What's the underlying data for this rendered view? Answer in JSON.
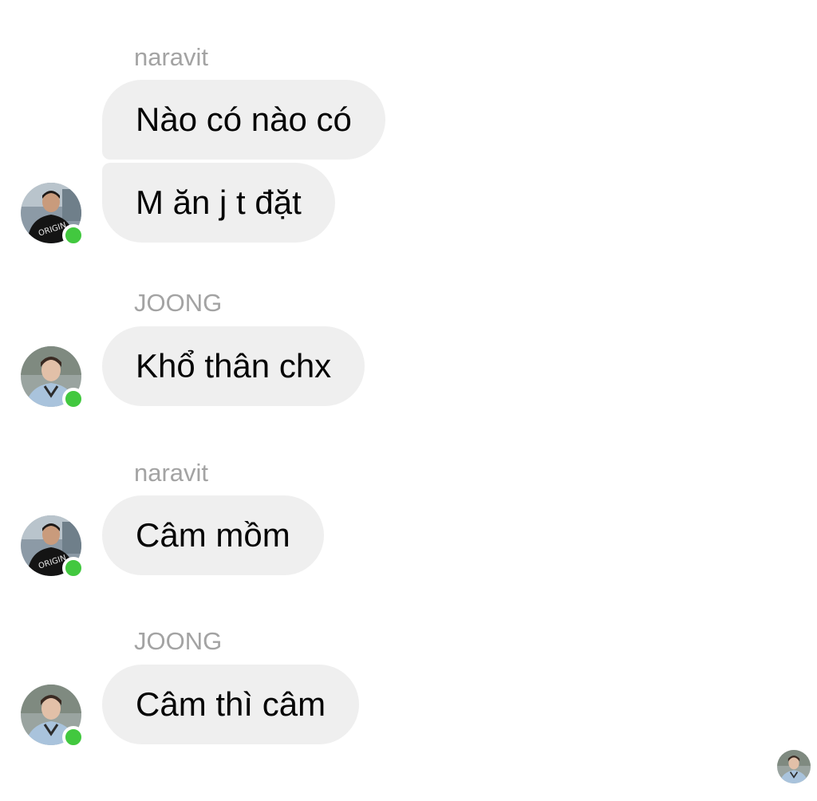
{
  "conversation": {
    "groups": [
      {
        "sender": "naravit",
        "avatar_icon": "person-in-black-tshirt-avatar",
        "online": true,
        "messages": [
          "Nào có nào có",
          "M ăn j t đặt"
        ]
      },
      {
        "sender": "JOONG",
        "avatar_icon": "person-in-light-shirt-avatar",
        "online": true,
        "messages": [
          "Khổ thân chx"
        ]
      },
      {
        "sender": "naravit",
        "avatar_icon": "person-in-black-tshirt-avatar",
        "online": true,
        "messages": [
          "Câm mồm"
        ]
      },
      {
        "sender": "JOONG",
        "avatar_icon": "person-in-light-shirt-avatar",
        "online": true,
        "messages": [
          "Câm thì câm"
        ]
      }
    ],
    "seen_by_icon": "read-receipt-avatar"
  },
  "colors": {
    "bubble_bg": "#efefef",
    "sender_name": "#a3a3a3",
    "online_dot": "#42c83f",
    "text": "#050505"
  }
}
